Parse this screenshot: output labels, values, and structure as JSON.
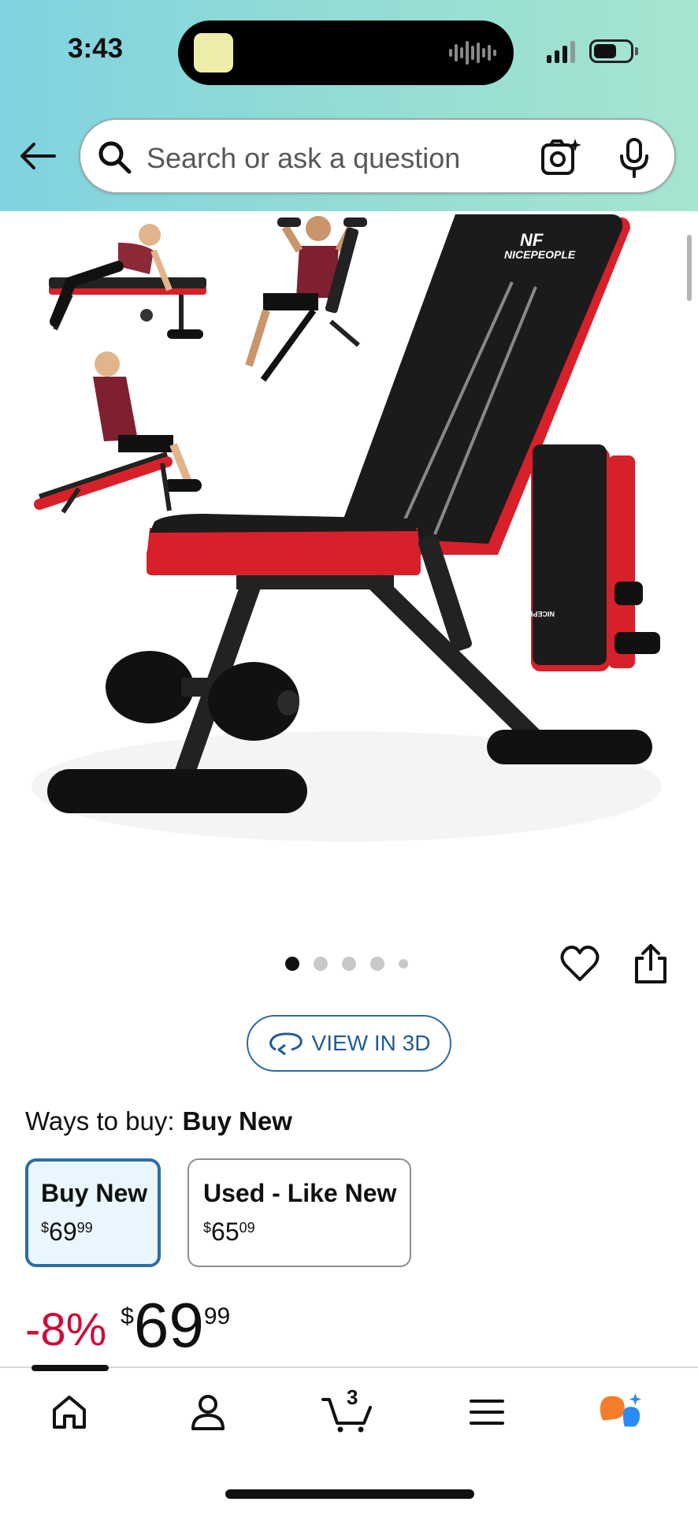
{
  "status_bar": {
    "time": "3:43"
  },
  "search": {
    "placeholder": "Search or ask a question"
  },
  "product": {
    "brand_logo_text": "NICEPEOPLE",
    "image_count": 5,
    "active_image": 1
  },
  "view3d": {
    "label": "VIEW IN 3D"
  },
  "ways_to_buy": {
    "label": "Ways to buy:",
    "selected": "Buy New",
    "options": [
      {
        "title": "Buy New",
        "price_symbol": "$",
        "price_whole": "69",
        "price_fraction": "99",
        "selected": true
      },
      {
        "title": "Used - Like New",
        "price_symbol": "$",
        "price_whole": "65",
        "price_fraction": "09",
        "selected": false
      }
    ]
  },
  "price": {
    "discount": "-8%",
    "symbol": "$",
    "whole": "69",
    "fraction": "99"
  },
  "bottom_nav": {
    "items": [
      "home-icon",
      "profile-icon",
      "cart-icon",
      "menu-icon",
      "rufus-icon"
    ],
    "cart_count": "3"
  },
  "colors": {
    "header_gradient_start": "#7fd3e0",
    "header_gradient_end": "#a6e5d0",
    "accent_blue": "#2a6ea6",
    "discount_red": "#cc0c39",
    "bench_red": "#d8202a",
    "rufus_orange": "#f57d2a",
    "rufus_blue": "#2a8bf5"
  }
}
